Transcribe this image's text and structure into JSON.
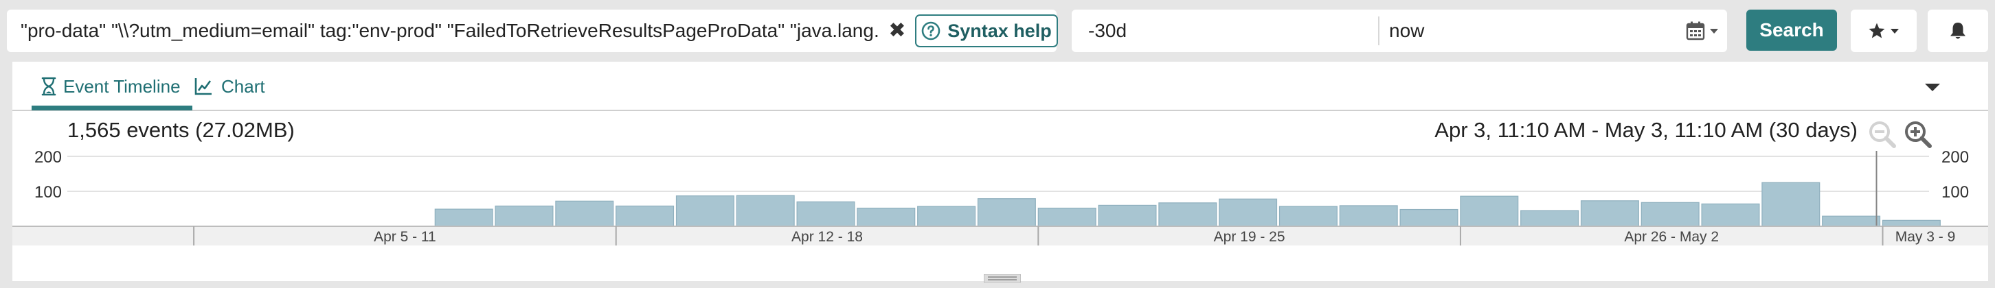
{
  "search": {
    "query": "\"pro-data\" \"\\\\?utm_medium=email\" tag:\"env-prod\" \"FailedToRetrieveResultsPageProData\" \"java.lang.NullPointerException\"",
    "clear_icon": "close-icon",
    "syntax_help_label": "Syntax help",
    "syntax_help_icon": "question-circle-icon"
  },
  "time_range": {
    "from_value": "-30d",
    "to_value": "now",
    "calendar_icon": "calendar-icon"
  },
  "toolbar": {
    "search_label": "Search",
    "favorites_icon": "star-icon",
    "alerts_icon": "bell-icon"
  },
  "colors": {
    "accent": "#2e7d80",
    "bar_fill": "#a8c5d1",
    "bar_stroke": "#8fb0be"
  },
  "tabs": [
    {
      "label": "Event Timeline",
      "icon": "hourglass-icon",
      "active": true
    },
    {
      "label": "Chart",
      "icon": "line-chart-icon",
      "active": false
    }
  ],
  "summary": {
    "events": "1,565 events (27.02MB)",
    "range": "Apr 3, 11:10 AM - May 3, 11:10 AM  (30 days)"
  },
  "chart_data": {
    "type": "bar",
    "y_ticks": [
      {
        "value": 200,
        "label": "200"
      },
      {
        "value": 100,
        "label": "100"
      }
    ],
    "ylim": [
      0,
      200
    ],
    "days": [
      "Apr 3",
      "Apr 4",
      "Apr 5",
      "Apr 6",
      "Apr 7",
      "Apr 8",
      "Apr 9",
      "Apr 10",
      "Apr 11",
      "Apr 12",
      "Apr 13",
      "Apr 14",
      "Apr 15",
      "Apr 16",
      "Apr 17",
      "Apr 18",
      "Apr 19",
      "Apr 20",
      "Apr 21",
      "Apr 22",
      "Apr 23",
      "Apr 24",
      "Apr 25",
      "Apr 26",
      "Apr 27",
      "Apr 28",
      "Apr 29",
      "Apr 30",
      "May 1",
      "May 2",
      "May 3"
    ],
    "values": [
      0,
      0,
      0,
      0,
      0,
      0,
      49,
      58,
      72,
      58,
      87,
      88,
      70,
      52,
      57,
      79,
      52,
      60,
      67,
      78,
      57,
      59,
      48,
      86,
      45,
      73,
      68,
      64,
      125,
      29,
      17
    ],
    "x_bands": [
      {
        "label": "Apr 5 - 11",
        "start_day": 2,
        "end_day": 9
      },
      {
        "label": "Apr 12 - 18",
        "start_day": 9,
        "end_day": 16
      },
      {
        "label": "Apr 19 - 25",
        "start_day": 16,
        "end_day": 23
      },
      {
        "label": "Apr 26 - May 2",
        "start_day": 23,
        "end_day": 30
      },
      {
        "label": "May 3 - 9",
        "start_day": 30,
        "end_day": 37
      }
    ],
    "grid": true,
    "cursor_day": 30
  }
}
